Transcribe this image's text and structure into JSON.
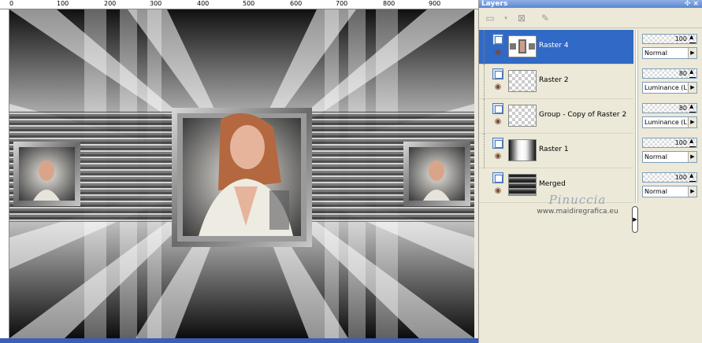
{
  "palette": {
    "title": "Layers",
    "title_buttons": "✣ ×"
  },
  "ruler": {
    "labels": [
      "0",
      "100",
      "200",
      "300",
      "400",
      "500",
      "600",
      "700",
      "800",
      "900"
    ]
  },
  "layers": [
    {
      "name": "Raster 4",
      "opacity": "100",
      "blend": "Normal",
      "selected": true,
      "thumb": "image"
    },
    {
      "name": "Raster 2",
      "opacity": "80",
      "blend": "Luminance (L)",
      "selected": false,
      "thumb": "transparent"
    },
    {
      "name": "Group - Copy of Raster 2",
      "opacity": "80",
      "blend": "Luminance (L)",
      "selected": false,
      "thumb": "transparent"
    },
    {
      "name": "Raster 1",
      "opacity": "100",
      "blend": "Normal",
      "selected": false,
      "thumb": "raster1"
    },
    {
      "name": "Merged",
      "opacity": "100",
      "blend": "Normal",
      "selected": false,
      "thumb": "bars"
    }
  ],
  "watermark": {
    "name": "Pinuccia",
    "site": "www.maidiregrafica.eu"
  },
  "colors": {
    "selection": "#3169c6",
    "panel_bg": "#ece9d8"
  }
}
